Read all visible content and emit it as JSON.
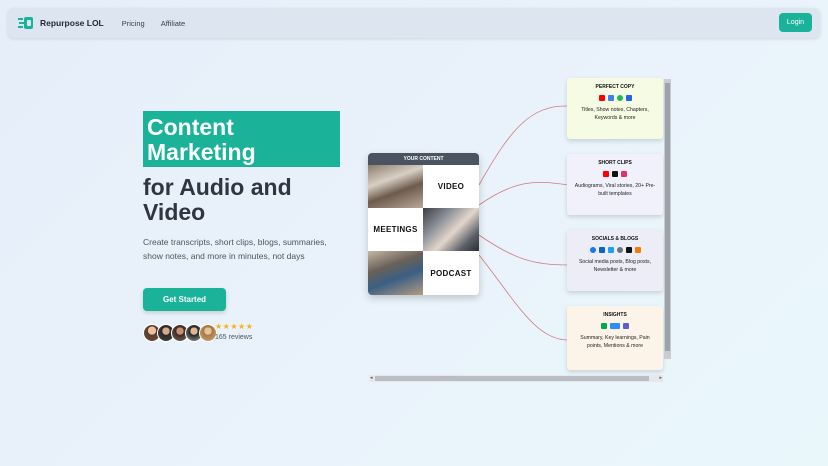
{
  "nav": {
    "brand": "Repurpose LOL",
    "links": [
      "Pricing",
      "Affiliate"
    ],
    "login": "Login"
  },
  "hero": {
    "highlight_line1": "Content",
    "highlight_line2": "Marketing",
    "dark_line1": "for Audio and",
    "dark_line2": "Video",
    "subtitle": "Create transcripts, short clips, blogs, summaries, show notes, and more in minutes, not days",
    "cta": "Get Started",
    "stars": "★★★★★",
    "reviews": "165 reviews"
  },
  "your_content": {
    "header": "YOUR CONTENT",
    "video": "VIDEO",
    "meetings": "MEETINGS",
    "podcast": "PODCAST"
  },
  "cards": [
    {
      "title": "PERFECT COPY",
      "desc": "Titles, Show notes, Chapters, Keywords & more",
      "icons": [
        "youtube-icon",
        "docs-icon",
        "spotify-icon",
        "file-icon"
      ],
      "bg": "#f6fbe3"
    },
    {
      "title": "SHORT CLIPS",
      "desc": "Audiograms, Viral stories, 20+ Pre-built templates",
      "icons": [
        "youtube-icon",
        "tiktok-icon",
        "instagram-icon"
      ],
      "bg": "#f0f1fb"
    },
    {
      "title": "SOCIALS & BLOGS",
      "desc": "Social media posts, Blog posts, Newsletter & more",
      "icons": [
        "facebook-icon",
        "linkedin-icon",
        "twitter-icon",
        "threads-icon",
        "medium-icon",
        "blogger-icon"
      ],
      "bg": "#ecedf7"
    },
    {
      "title": "INSIGHTS",
      "desc": "Summary, Key learnings, Pain points, Mentions & more",
      "icons": [
        "meet-icon",
        "zoom-icon",
        "teams-icon"
      ],
      "bg": "#fdf4e9"
    }
  ],
  "colors": {
    "accent": "#1ab39a",
    "dark": "#2f3640"
  }
}
